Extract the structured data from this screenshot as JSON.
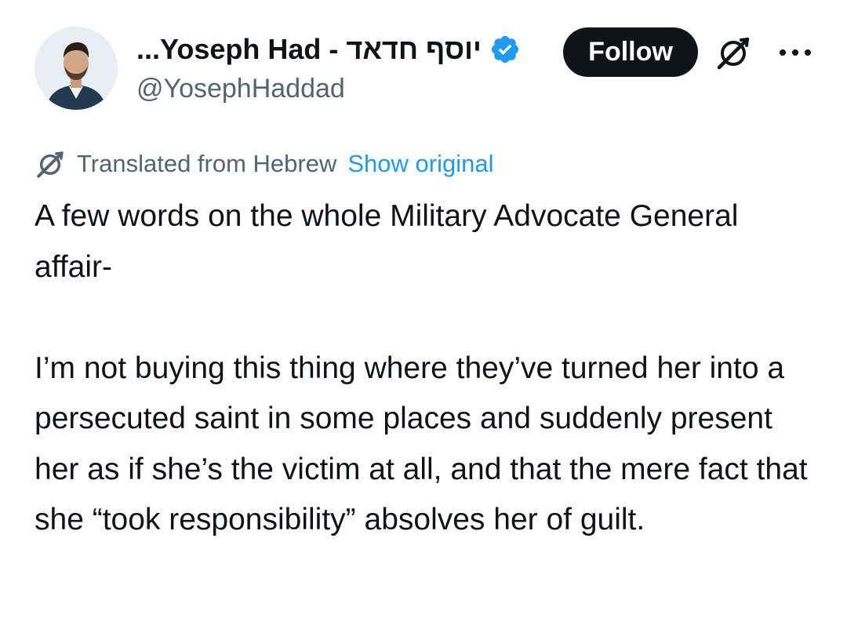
{
  "author": {
    "display_name": "יוסף חדאד - Yoseph Had...",
    "handle": "@YosephHaddad",
    "verified": true
  },
  "actions": {
    "follow_label": "Follow",
    "grok_icon": "grok-icon",
    "more_icon": "more-horizontal-icon"
  },
  "translation": {
    "icon": "translate-icon",
    "label": "Translated from Hebrew",
    "show_original_label": "Show original"
  },
  "tweet": {
    "paragraph_1": "A few words on the whole Military Advocate General affair-",
    "paragraph_2": "I’m not buying this thing where they’ve turned her into a persecuted saint in some places and suddenly present her as if she’s the victim at all, and that the mere fact that she “took responsibility” absolves her of guilt."
  },
  "colors": {
    "text_primary": "#0f1419",
    "text_secondary": "#536471",
    "link": "#1d9bf0",
    "verified_badge": "#1d9bf0",
    "follow_bg": "#0f1419"
  }
}
